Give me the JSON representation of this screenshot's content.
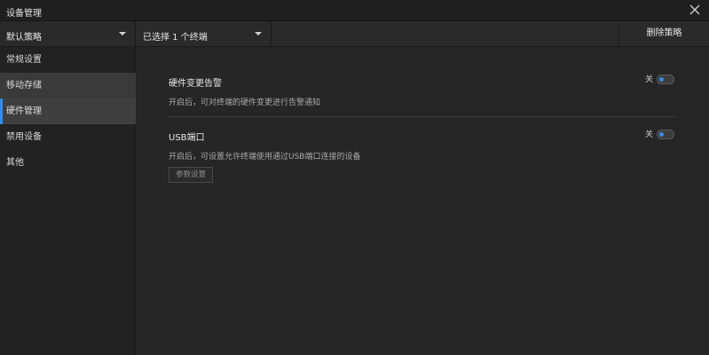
{
  "window": {
    "title": "设备管理"
  },
  "toolbar": {
    "policy_value": "默认策略",
    "terminal_value": "已选择 1 个终端",
    "delete_label": "删除策略"
  },
  "sidebar": {
    "items": [
      {
        "label": "常规设置"
      },
      {
        "label": "移动存储"
      },
      {
        "label": "硬件管理"
      },
      {
        "label": "禁用设备"
      },
      {
        "label": "其他"
      }
    ],
    "active_index": 2
  },
  "main": {
    "sections": [
      {
        "title": "硬件变更告警",
        "description": "开启后，可对终端的硬件变更进行告警通知",
        "toggle_label": "关"
      },
      {
        "title": "USB端口",
        "description": "开启后，可设置允许终端使用通过USB端口连接的设备",
        "toggle_label": "关",
        "button_label": "参数设置"
      }
    ]
  },
  "colors": {
    "accent": "#2d8cf0"
  }
}
